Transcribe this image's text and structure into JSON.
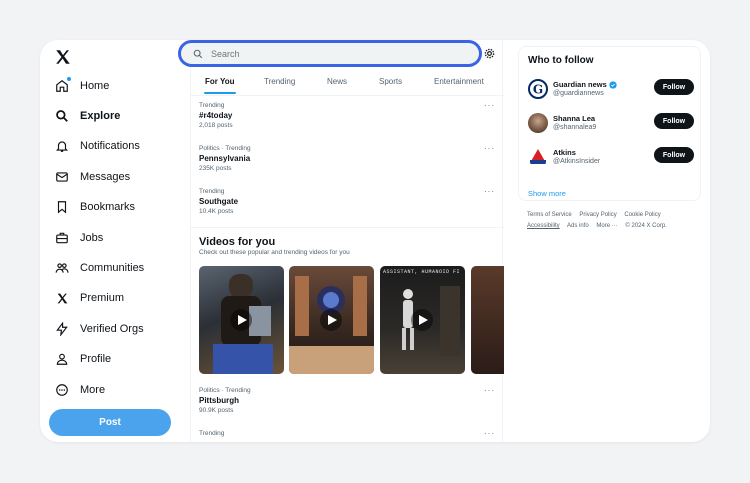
{
  "search": {
    "placeholder": "Search"
  },
  "sidebar": {
    "items": [
      {
        "label": "Home",
        "icon": "home-icon"
      },
      {
        "label": "Explore",
        "icon": "search-icon"
      },
      {
        "label": "Notifications",
        "icon": "bell-icon"
      },
      {
        "label": "Messages",
        "icon": "envelope-icon"
      },
      {
        "label": "Bookmarks",
        "icon": "bookmark-icon"
      },
      {
        "label": "Jobs",
        "icon": "briefcase-icon"
      },
      {
        "label": "Communities",
        "icon": "people-icon"
      },
      {
        "label": "Premium",
        "icon": "x-logo-icon"
      },
      {
        "label": "Verified Orgs",
        "icon": "lightning-icon"
      },
      {
        "label": "Profile",
        "icon": "person-icon"
      },
      {
        "label": "More",
        "icon": "more-circle-icon"
      }
    ],
    "post_label": "Post"
  },
  "tabs": [
    "For You",
    "Trending",
    "News",
    "Sports",
    "Entertainment"
  ],
  "trends": [
    {
      "context": "Trending",
      "name": "#r4today",
      "count": "2,018 posts"
    },
    {
      "context": "Politics · Trending",
      "name": "Pennsylvania",
      "count": "235K posts"
    },
    {
      "context": "Trending",
      "name": "Southgate",
      "count": "10.4K posts"
    }
  ],
  "videos": {
    "title": "Videos for you",
    "subtitle": "Check out these popular and trending videos for you",
    "thumb3_text": "ASSISTANT, HUMANOID FI"
  },
  "trends_after": [
    {
      "context": "Politics · Trending",
      "name": "Pittsburgh",
      "count": "90.9K posts"
    },
    {
      "context": "Trending",
      "name": "",
      "count": ""
    }
  ],
  "more_label": "···",
  "who_to_follow": {
    "title": "Who to follow",
    "accounts": [
      {
        "name": "Guardian news",
        "handle": "@guardiannews",
        "verified": true
      },
      {
        "name": "Shanna Lea",
        "handle": "@shannalea9",
        "verified": false
      },
      {
        "name": "Atkins",
        "handle": "@AtkinsInsider",
        "verified": false
      }
    ],
    "follow_label": "Follow",
    "show_more": "Show more"
  },
  "footer": {
    "links": [
      "Terms of Service",
      "Privacy Policy",
      "Cookie Policy",
      "Accessibility",
      "Ads info",
      "More ···",
      "© 2024 X Corp."
    ]
  },
  "colors": {
    "accent": "#1d9bf0",
    "search_border": "#3b63e6",
    "post_button": "#4aa3ec"
  }
}
